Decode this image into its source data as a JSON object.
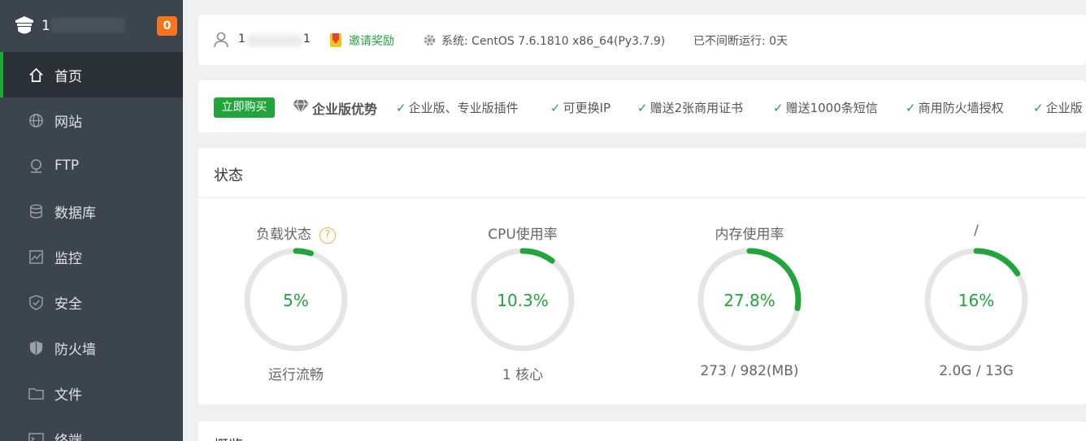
{
  "sidebar": {
    "brand_name": "1",
    "badge_count": "0",
    "items": [
      {
        "label": "首页",
        "icon": "home-icon"
      },
      {
        "label": "网站",
        "icon": "globe-icon"
      },
      {
        "label": "FTP",
        "icon": "ftp-icon"
      },
      {
        "label": "数据库",
        "icon": "database-icon"
      },
      {
        "label": "监控",
        "icon": "monitor-icon"
      },
      {
        "label": "安全",
        "icon": "shield-check-icon"
      },
      {
        "label": "防火墙",
        "icon": "shield-icon"
      },
      {
        "label": "文件",
        "icon": "folder-icon"
      },
      {
        "label": "终端",
        "icon": "terminal-icon"
      }
    ]
  },
  "topbar": {
    "user_head": "1",
    "user_tail": "1",
    "invite_label": "邀请奖励",
    "system_text": "系统:  CentOS 7.6.1810 x86_64(Py3.7.9)",
    "uptime_text": "已不间断运行: 0天"
  },
  "promo": {
    "buy_label": "立即购买",
    "title": "企业版优势",
    "features": [
      "企业版、专业版插件",
      "可更换IP",
      "赠送2张商用证书",
      "赠送1000条短信",
      "商用防火墙授权",
      "企业版"
    ]
  },
  "status": {
    "title": "状态",
    "gauges": [
      {
        "label": "负载状态",
        "value": "5%",
        "percent": 5,
        "sub": "运行流畅",
        "help": "?"
      },
      {
        "label": "CPU使用率",
        "value": "10.3%",
        "percent": 10.3,
        "sub": "1 核心"
      },
      {
        "label": "内存使用率",
        "value": "27.8%",
        "percent": 27.8,
        "sub": "273 / 982(MB)"
      },
      {
        "label": "/",
        "value": "16%",
        "percent": 16,
        "sub": "2.0G / 13G"
      }
    ]
  },
  "next_section": {
    "title": "概览"
  },
  "colors": {
    "accent": "#20a53a",
    "sidebar": "#3c444d",
    "badge": "#f7751e"
  }
}
